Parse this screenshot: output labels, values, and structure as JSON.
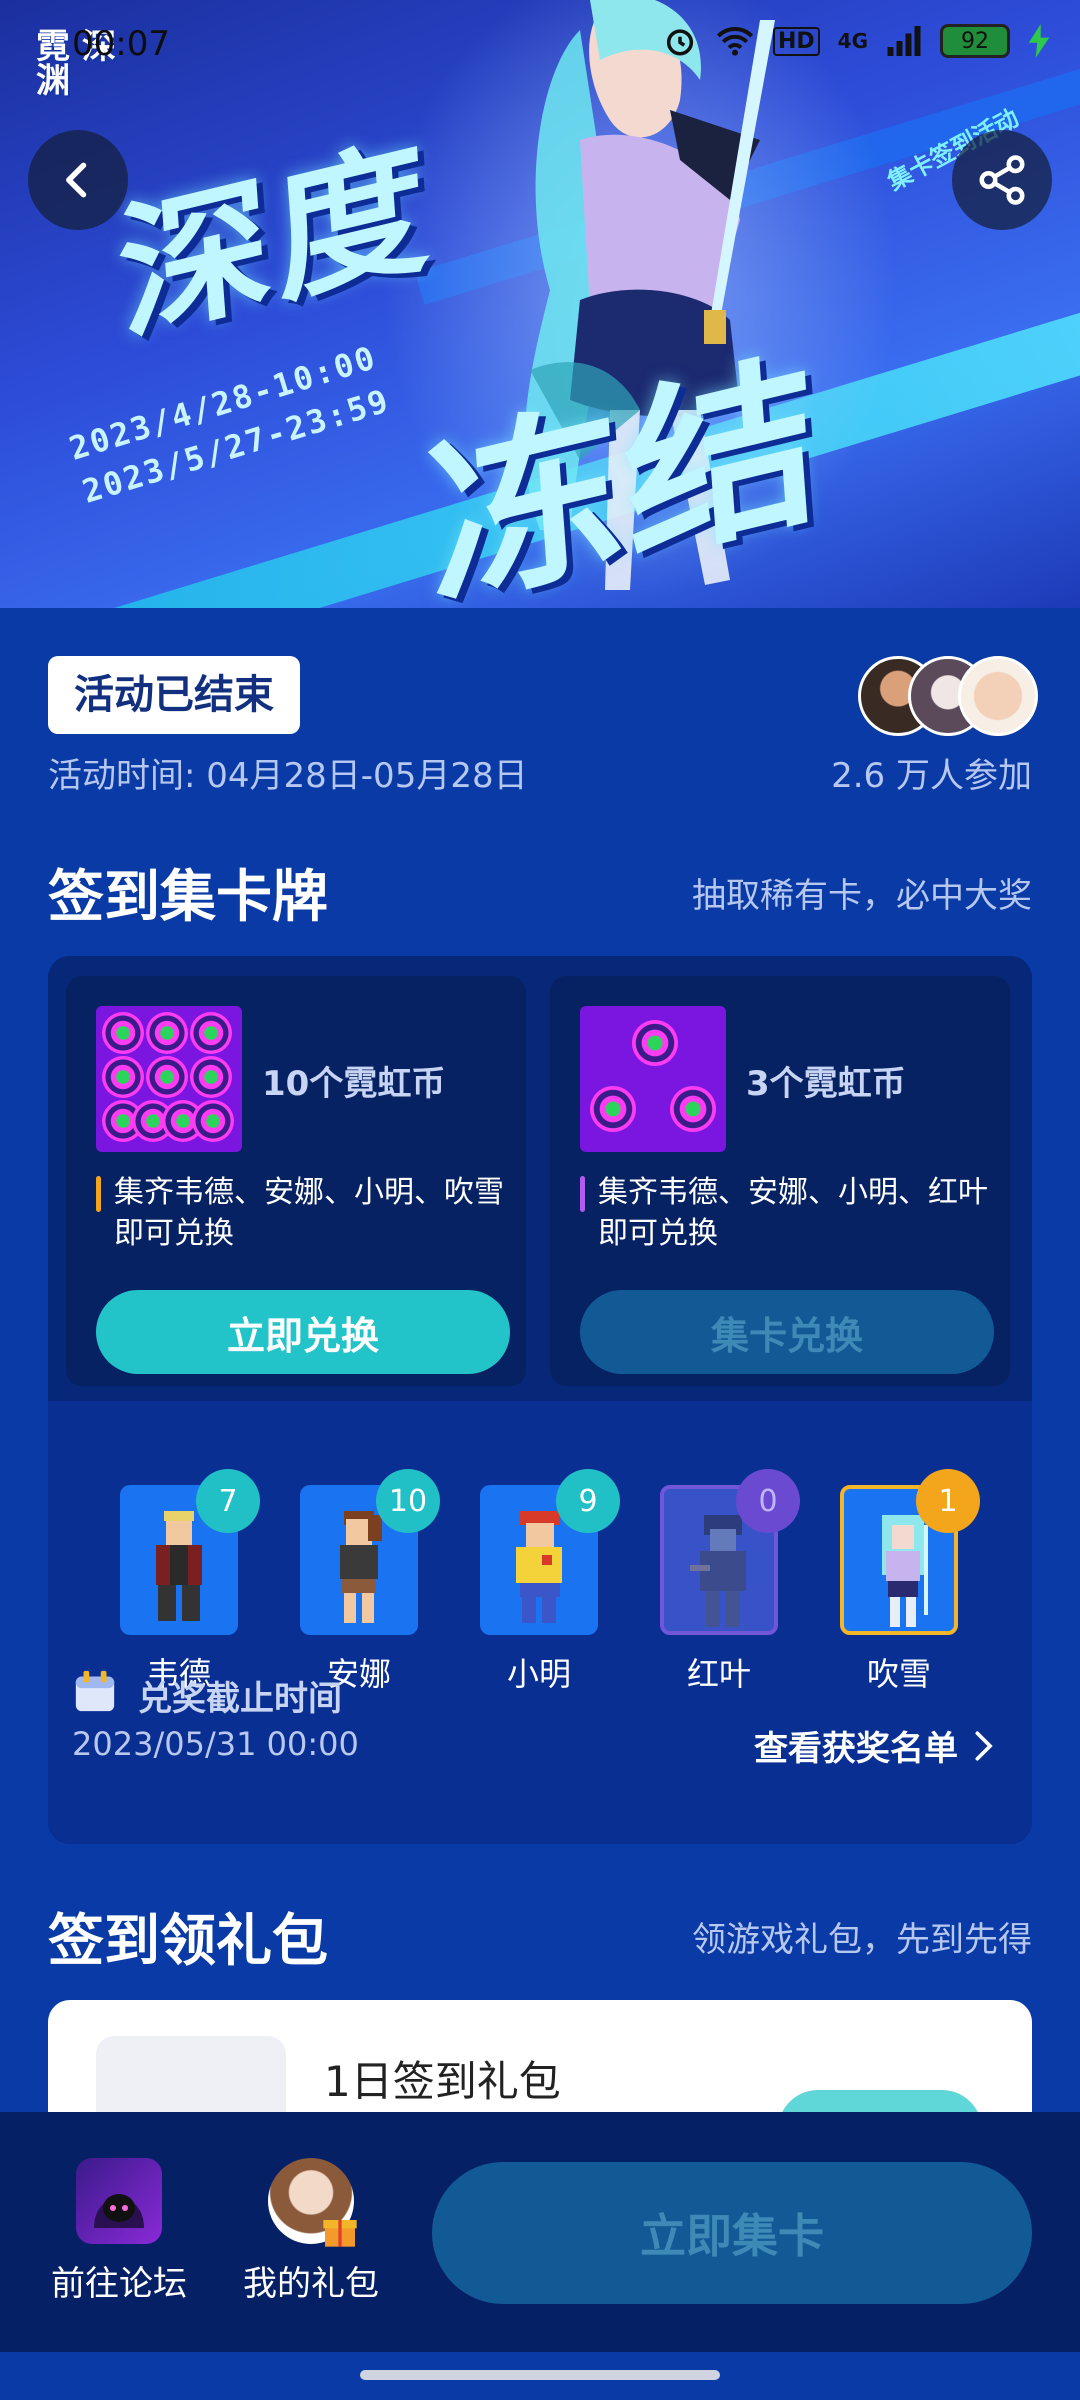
{
  "status_bar": {
    "time": "00:07",
    "battery": "92",
    "network": "4G"
  },
  "banner": {
    "logo": "霓 深渊",
    "title_top": "深度",
    "title_bottom": "冻结",
    "date_start": "2023/4/28-10:00",
    "date_end": "2023/5/27-23:59",
    "side_text": "集卡签到活动"
  },
  "info": {
    "status": "活动已结束",
    "activity_time": "活动时间: 04月28日-05月28日",
    "participants": "2.6 万人参加"
  },
  "cards_section": {
    "title": "签到集卡牌",
    "subtitle": "抽取稀有卡，必中大奖",
    "exchanges": [
      {
        "label": "10个霓虹币",
        "desc_line1": "集齐韦德、安娜、小明、吹雪",
        "desc_line2": "即可兑换",
        "button": "立即兑换",
        "bar_color": "#f3a51b"
      },
      {
        "label": "3个霓虹币",
        "desc_line1": "集齐韦德、安娜、小明、红叶",
        "desc_line2": "即可兑换",
        "button": "集卡兑换",
        "bar_color": "#b15cf0"
      }
    ],
    "characters": [
      {
        "name": "韦德",
        "count": "7"
      },
      {
        "name": "安娜",
        "count": "10"
      },
      {
        "name": "小明",
        "count": "9"
      },
      {
        "name": "红叶",
        "count": "0"
      },
      {
        "name": "吹雪",
        "count": "1"
      }
    ],
    "deadline_label": "兑奖截止时间",
    "deadline_value": "2023/05/31 00:00",
    "winners_link": "查看获奖名单"
  },
  "gift_section": {
    "title": "签到领礼包",
    "subtitle": "领游戏礼包，先到先得",
    "first_gift": "1日签到礼包"
  },
  "bottom_bar": {
    "forum": "前往论坛",
    "my_gifts": "我的礼包",
    "collect": "立即集卡"
  }
}
